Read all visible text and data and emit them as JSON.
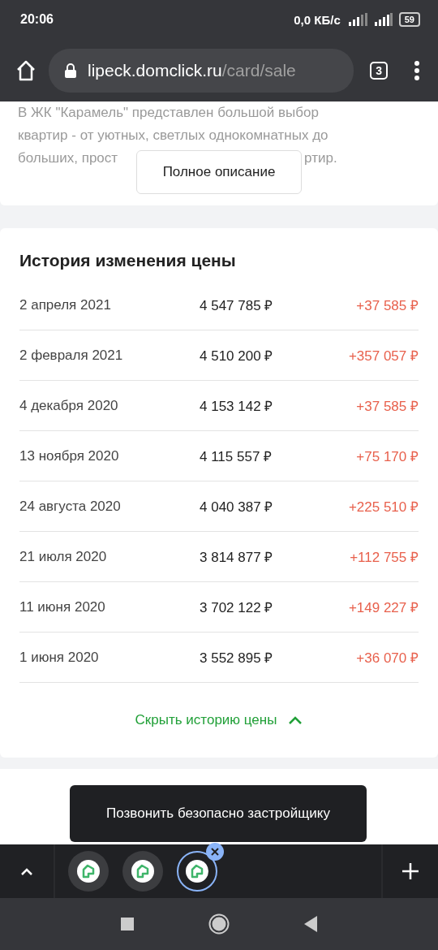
{
  "status_bar": {
    "time": "20:06",
    "speed": "0,0 КБ/с",
    "battery": "59"
  },
  "browser": {
    "url_host": "lipeck.domclick.ru",
    "url_path": "/card/sale",
    "tab_count": "3"
  },
  "description": {
    "lines": [
      "В ЖК \"Карамель\" представлен большой выбор",
      "квартир - от уютных, светлых однокомнатных до"
    ],
    "partial_left": "больших, прост",
    "partial_right": "ртир.",
    "button": "Полное описание"
  },
  "price_history": {
    "title": "История изменения цены",
    "rows": [
      {
        "date": "2 апреля 2021",
        "price": "4 547 785 ₽",
        "change": "+37 585 ₽"
      },
      {
        "date": "2 февраля 2021",
        "price": "4 510 200 ₽",
        "change": "+357 057 ₽"
      },
      {
        "date": "4 декабря 2020",
        "price": "4 153 142 ₽",
        "change": "+37 585 ₽"
      },
      {
        "date": "13 ноября 2020",
        "price": "4 115 557 ₽",
        "change": "+75 170 ₽"
      },
      {
        "date": "24 августа 2020",
        "price": "4 040 387 ₽",
        "change": "+225 510 ₽"
      },
      {
        "date": "21 июля 2020",
        "price": "3 814 877 ₽",
        "change": "+112 755 ₽"
      },
      {
        "date": "11 июня 2020",
        "price": "3 702 122 ₽",
        "change": "+149 227 ₽"
      },
      {
        "date": "1 июня 2020",
        "price": "3 552 895 ₽",
        "change": "+36 070 ₽"
      }
    ],
    "toggle": "Скрыть историю цены",
    "expanded": true
  },
  "call_button": "Позвонить безопасно застройщику",
  "tab_strip": {
    "tabs": [
      {
        "selected": false
      },
      {
        "selected": false
      },
      {
        "selected": true
      }
    ]
  }
}
